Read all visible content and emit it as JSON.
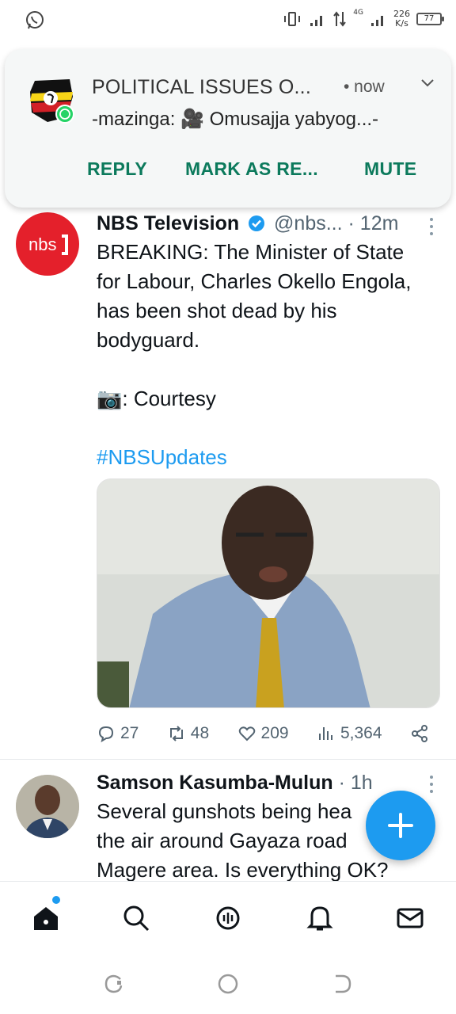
{
  "status_bar": {
    "speed_value": "226",
    "speed_unit": "K/s",
    "network": "4G",
    "battery": "77"
  },
  "notification": {
    "title": "POLITICAL ISSUES O...",
    "time": "• now",
    "body": "-mazinga: 🎥 Omusajja yabyog...-",
    "actions": [
      "REPLY",
      "MARK AS RE...",
      "MUTE"
    ]
  },
  "tweets": [
    {
      "author": "NBS Television",
      "handle": "@nbs...",
      "age": "· 12m",
      "text_lines": [
        "BREAKING: The Minister of State",
        "for Labour, Charles Okello Engola,",
        "has been shot dead by his",
        "bodyguard."
      ],
      "credit": "📷: Courtesy",
      "hashtag": "#NBSUpdates",
      "replies": "27",
      "retweets": "48",
      "likes": "209",
      "views": "5,364",
      "avatar_text": "nbs"
    },
    {
      "author": "Samson Kasumba-Mulun",
      "age": "· 1h",
      "text_lines": [
        "Several gunshots being hea",
        "the air around Gayaza road",
        "Magere area. Is everything OK?"
      ]
    }
  ],
  "colors": {
    "accent": "#1d9bf0",
    "notification_action": "#0c7a5c",
    "nbs_red": "#e4202b"
  }
}
